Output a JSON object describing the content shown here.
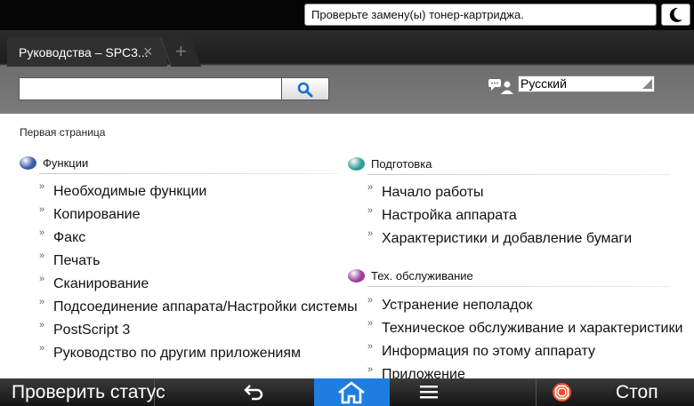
{
  "status": {
    "message": "Проверьте замену(ы) тонер-картриджа."
  },
  "browser": {
    "tab_title": "Руководства – SPC3...",
    "tab_close": "×",
    "new_tab": "+",
    "search_value": "",
    "language": "Русский"
  },
  "page": {
    "breadcrumb": "Первая страница",
    "left_section": {
      "title": "Функции",
      "color": "#3b5aa8",
      "items": [
        "Необходимые функции",
        "Копирование",
        "Факс",
        "Печать",
        "Сканирование",
        "Подсоединение аппарата/Настройки системы",
        "PostScript 3",
        "Руководство по другим приложениям"
      ]
    },
    "right_sections": [
      {
        "title": "Подготовка",
        "color": "#2f9c98",
        "items": [
          "Начало работы",
          "Настройка аппарата",
          "Характеристики и добавление бумаги"
        ]
      },
      {
        "title": "Тех. обслуживание",
        "color": "#9a3f9b",
        "items": [
          "Устранение неполадок",
          "Техническое обслуживание и характеристики",
          "Информация по этому аппарату",
          "Приложение"
        ]
      }
    ],
    "chevron": "»"
  },
  "bottom": {
    "check_status": "Проверить статус",
    "stop": "Стоп",
    "home_color": "#1d7ee0"
  }
}
